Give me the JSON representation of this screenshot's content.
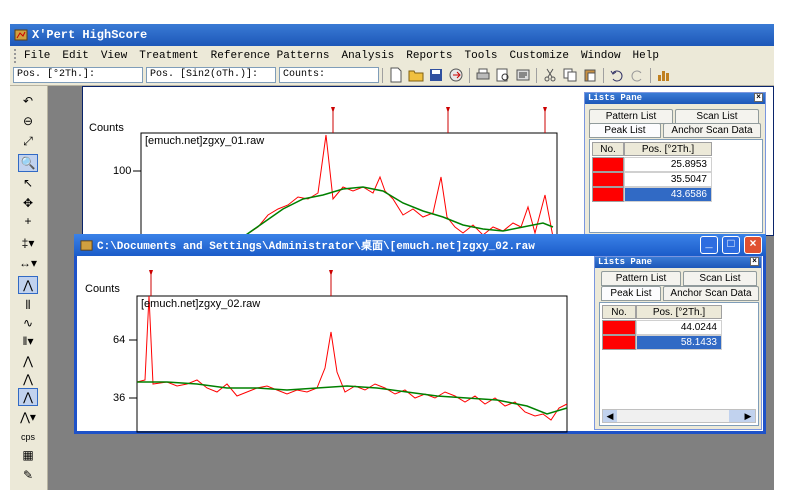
{
  "app": {
    "title": "X'Pert HighScore"
  },
  "menu": [
    "File",
    "Edit",
    "View",
    "Treatment",
    "Reference Patterns",
    "Analysis",
    "Reports",
    "Tools",
    "Customize",
    "Window",
    "Help"
  ],
  "toolbar": {
    "field1": "Pos. [°2Th.]:",
    "field2": "Pos. [Sin2(oTh.)]:",
    "field3": "Counts:"
  },
  "left_toolbar": {
    "cps_label": "cps"
  },
  "doc1": {
    "ylabel": "Counts",
    "file_label": "[emuch.net]zgxy_01.raw",
    "tick_100": "100"
  },
  "doc2": {
    "title": "C:\\Documents and Settings\\Administrator\\桌面\\[emuch.net]zgxy_02.raw",
    "ylabel": "Counts",
    "file_label": "[emuch.net]zgxy_02.raw",
    "tick_64": "64",
    "tick_36": "36"
  },
  "lists_pane_1": {
    "title": "Lists Pane",
    "tabs": {
      "pattern": "Pattern List",
      "scan": "Scan List",
      "peak": "Peak List",
      "anchor": "Anchor Scan Data"
    },
    "col_no": "No.",
    "col_pos": "Pos. [°2Th.]",
    "rows": [
      "25.8953",
      "35.5047",
      "43.6586"
    ]
  },
  "lists_pane_2": {
    "title": "Lists Pane",
    "tabs": {
      "pattern": "Pattern List",
      "scan": "Scan List",
      "peak": "Peak List",
      "anchor": "Anchor Scan Data"
    },
    "col_no": "No.",
    "col_pos": "Pos. [°2Th.]",
    "rows": [
      "44.0244",
      "58.1433"
    ]
  },
  "colors": {
    "title_blue": "#1d57b8",
    "peak_red": "#ff0000",
    "fit_green": "#008000",
    "selection": "#316ac5"
  }
}
